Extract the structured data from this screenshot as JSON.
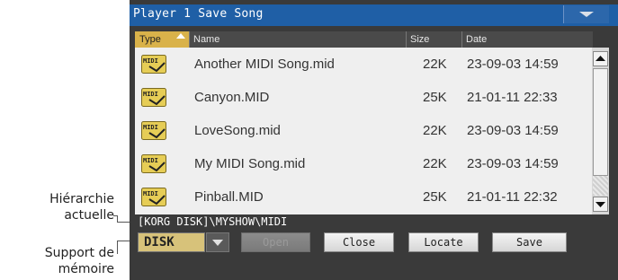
{
  "callouts": {
    "hierarchy": [
      "Hiérarchie",
      "actuelle"
    ],
    "storage": [
      "Support de",
      "mémoire"
    ]
  },
  "window": {
    "title": "Player 1  Save Song"
  },
  "columns": {
    "type": "Type",
    "name": "Name",
    "size": "Size",
    "date": "Date"
  },
  "files": [
    {
      "icon": "midi-file-icon",
      "icon_text": "MIDI",
      "name": "Another MIDI Song.mid",
      "size": "22K",
      "date": "23-09-03 14:59"
    },
    {
      "icon": "midi-file-icon",
      "icon_text": "MIDI",
      "name": "Canyon.MID",
      "size": "25K",
      "date": "21-01-11 22:33"
    },
    {
      "icon": "midi-file-icon",
      "icon_text": "MIDI",
      "name": "LoveSong.mid",
      "size": "22K",
      "date": "23-09-03 14:59"
    },
    {
      "icon": "midi-file-icon",
      "icon_text": "MIDI",
      "name": "My MIDI Song.mid",
      "size": "22K",
      "date": "23-09-03 14:59"
    },
    {
      "icon": "midi-file-icon",
      "icon_text": "MIDI",
      "name": "Pinball.MID",
      "size": "25K",
      "date": "21-01-11 22:32"
    }
  ],
  "path": "[KORG DISK]\\MYSHOW\\MIDI",
  "device": "DISK",
  "buttons": {
    "open": "Open",
    "close": "Close",
    "locate": "Locate",
    "save": "Save"
  },
  "colors": {
    "titlebar": "#1f5fa6",
    "selected_header": "#d9b24a",
    "device_field": "#d7c27a"
  }
}
